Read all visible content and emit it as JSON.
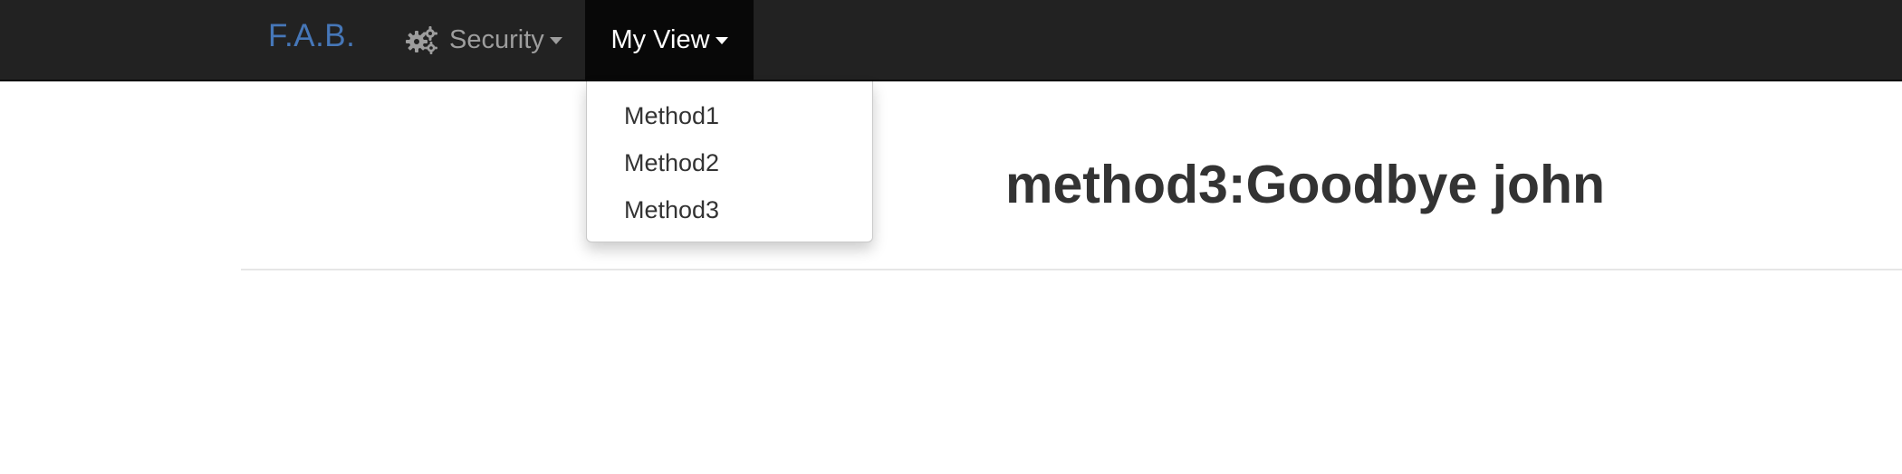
{
  "navbar": {
    "brand": "F.A.B.",
    "items": [
      {
        "label": "Security",
        "icon": "gears-icon",
        "has_dropdown": true
      },
      {
        "label": "My View",
        "has_dropdown": true,
        "active": true
      }
    ]
  },
  "dropdown": {
    "items": [
      {
        "label": "Method1"
      },
      {
        "label": "Method2"
      },
      {
        "label": "Method3"
      }
    ]
  },
  "main": {
    "title": "method3:Goodbye john"
  },
  "colors": {
    "navbar_bg": "#222222",
    "active_nav_bg": "#080808",
    "brand": "#4677b8",
    "nav_text": "#9d9d9d",
    "active_text": "#ffffff",
    "body_text": "#333333"
  }
}
